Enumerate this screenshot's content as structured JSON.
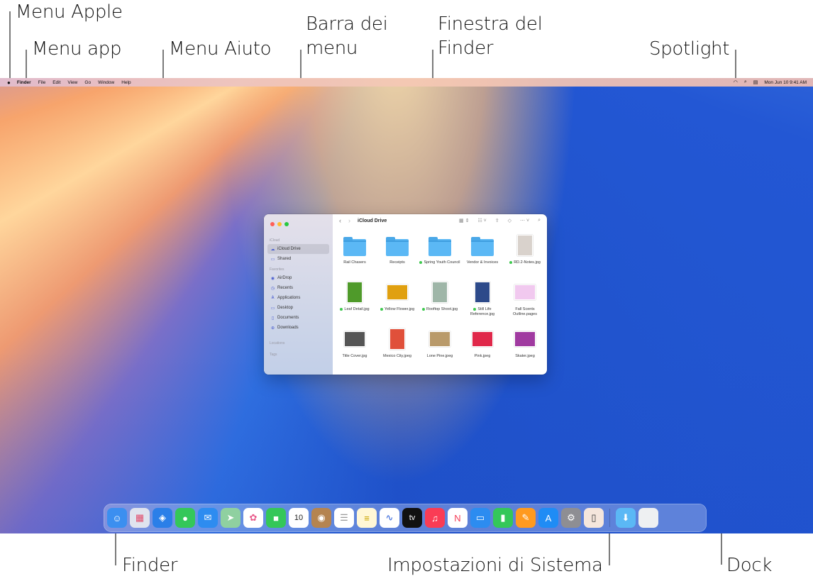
{
  "callouts": {
    "apple_menu": "Menu Apple",
    "app_menu": "Menu app",
    "help_menu": "Menu Aiuto",
    "menu_bar_line1": "Barra dei",
    "menu_bar_line2": "menu",
    "finder_window_line1": "Finestra del",
    "finder_window_line2": "Finder",
    "spotlight": "Spotlight",
    "finder": "Finder",
    "system_settings": "Impostazioni di Sistema",
    "dock": "Dock"
  },
  "menubar": {
    "apple_icon": "apple-icon",
    "items": [
      "Finder",
      "File",
      "Edit",
      "View",
      "Go",
      "Window",
      "Help"
    ],
    "status": {
      "wifi_icon": "wifi-icon",
      "spotlight_icon": "search-icon",
      "control_center_icon": "control-center-icon",
      "datetime": "Mon Jun 10  9:41 AM"
    }
  },
  "finder": {
    "title": "iCloud Drive",
    "sidebar": {
      "sections": [
        {
          "header": "iCloud",
          "items": [
            {
              "label": "iCloud Drive",
              "icon": "cloud-icon",
              "active": true
            },
            {
              "label": "Shared",
              "icon": "shared-folder-icon"
            }
          ]
        },
        {
          "header": "Favorites",
          "items": [
            {
              "label": "AirDrop",
              "icon": "airdrop-icon"
            },
            {
              "label": "Recents",
              "icon": "clock-icon"
            },
            {
              "label": "Applications",
              "icon": "applications-icon"
            },
            {
              "label": "Desktop",
              "icon": "desktop-icon"
            },
            {
              "label": "Documents",
              "icon": "document-icon"
            },
            {
              "label": "Downloads",
              "icon": "download-icon"
            }
          ]
        },
        {
          "header": "Locations",
          "items": []
        },
        {
          "header": "Tags",
          "items": []
        }
      ]
    },
    "toolbar": {
      "back_icon": "chevron-left-icon",
      "forward_icon": "chevron-right-icon",
      "view_icon": "grid-view-icon",
      "group_icon": "group-icon",
      "share_icon": "share-icon",
      "tag_icon": "tag-icon",
      "more_icon": "more-icon",
      "search_icon": "search-icon"
    },
    "files": [
      {
        "name": "Rail Chasers",
        "type": "folder",
        "tag": false
      },
      {
        "name": "Receipts",
        "type": "folder",
        "tag": false
      },
      {
        "name": "Spring Youth Council",
        "type": "folder",
        "tag": true
      },
      {
        "name": "Vendor & Invoices",
        "type": "folder",
        "tag": false
      },
      {
        "name": "RD.2-Notes.jpg",
        "type": "image",
        "tag": true,
        "color": "#d9d2cc"
      },
      {
        "name": "Leaf Detail.jpg",
        "type": "image",
        "tag": true,
        "color": "#4f9a2a"
      },
      {
        "name": "Yellow Flower.jpg",
        "type": "image",
        "tag": true,
        "color": "#e0a010"
      },
      {
        "name": "Rooftop Shoot.jpg",
        "type": "image",
        "tag": true,
        "color": "#9fb6a8"
      },
      {
        "name": "Still Life Reference.jpg",
        "type": "image",
        "tag": true,
        "color": "#2d4a8a"
      },
      {
        "name": "Fall Scents Outline.pages",
        "type": "document",
        "tag": false,
        "color": "#f1c9ef"
      },
      {
        "name": "Title Cover.jpg",
        "type": "image",
        "tag": false,
        "color": "#555555"
      },
      {
        "name": "Mexico City.jpeg",
        "type": "image",
        "tag": false,
        "color": "#e0503a"
      },
      {
        "name": "Lone Pine.jpeg",
        "type": "image",
        "tag": false,
        "color": "#b99a6a"
      },
      {
        "name": "Pink.jpeg",
        "type": "image",
        "tag": false,
        "color": "#e0284a"
      },
      {
        "name": "Skater.jpeg",
        "type": "image",
        "tag": false,
        "color": "#a03aa0"
      }
    ]
  },
  "dock": {
    "apps": [
      {
        "name": "Finder",
        "icon": "finder-icon",
        "glyph": "☺",
        "bg": "#3b8ff0"
      },
      {
        "name": "Launchpad",
        "icon": "launchpad-icon",
        "glyph": "▦",
        "bg": "#dfe3ee",
        "fg": "#e04a6a"
      },
      {
        "name": "Safari",
        "icon": "safari-icon",
        "glyph": "◈",
        "bg": "#2b7fe8"
      },
      {
        "name": "Messages",
        "icon": "messages-icon",
        "glyph": "●",
        "bg": "#34c759"
      },
      {
        "name": "Mail",
        "icon": "mail-icon",
        "glyph": "✉",
        "bg": "#2d8cf0"
      },
      {
        "name": "Maps",
        "icon": "maps-icon",
        "glyph": "➤",
        "bg": "#8fd0a0"
      },
      {
        "name": "Photos",
        "icon": "photos-icon",
        "glyph": "✿",
        "bg": "#ffffff",
        "fg": "#e85a8a"
      },
      {
        "name": "FaceTime",
        "icon": "facetime-icon",
        "glyph": "■",
        "bg": "#34c759"
      },
      {
        "name": "Calendar",
        "icon": "calendar-icon",
        "glyph": "10",
        "bg": "#ffffff",
        "fg": "#222"
      },
      {
        "name": "Contacts",
        "icon": "contacts-icon",
        "glyph": "◉",
        "bg": "#b58450"
      },
      {
        "name": "Reminders",
        "icon": "reminders-icon",
        "glyph": "☰",
        "bg": "#ffffff",
        "fg": "#999"
      },
      {
        "name": "Notes",
        "icon": "notes-icon",
        "glyph": "≡",
        "bg": "#fff7d6",
        "fg": "#c9a400"
      },
      {
        "name": "Freeform",
        "icon": "freeform-icon",
        "glyph": "∿",
        "bg": "#ffffff",
        "fg": "#2b5fd9"
      },
      {
        "name": "Apple TV",
        "icon": "apple-tv-icon",
        "glyph": "tv",
        "bg": "#111111"
      },
      {
        "name": "Music",
        "icon": "music-icon",
        "glyph": "♫",
        "bg": "#fa3c55"
      },
      {
        "name": "News",
        "icon": "news-icon",
        "glyph": "N",
        "bg": "#ffffff",
        "fg": "#f43b55"
      },
      {
        "name": "Keynote",
        "icon": "keynote-icon",
        "glyph": "▭",
        "bg": "#2c8cf0"
      },
      {
        "name": "Numbers",
        "icon": "numbers-icon",
        "glyph": "▮",
        "bg": "#34c759"
      },
      {
        "name": "Pages",
        "icon": "pages-icon",
        "glyph": "✎",
        "bg": "#ff9a1f"
      },
      {
        "name": "App Store",
        "icon": "app-store-icon",
        "glyph": "A",
        "bg": "#1f8cf5"
      },
      {
        "name": "System Settings",
        "icon": "gear-icon",
        "glyph": "⚙",
        "bg": "#8e8e93"
      },
      {
        "name": "iPhone Mirroring",
        "icon": "iphone-mirroring-icon",
        "glyph": "▯",
        "bg": "#f5e6dc",
        "fg": "#333"
      }
    ],
    "stacks": [
      {
        "name": "Downloads",
        "icon": "downloads-folder-icon",
        "glyph": "⬇",
        "bg": "#5bb8f5"
      },
      {
        "name": "Trash",
        "icon": "trash-icon",
        "glyph": "",
        "bg": "#eef0f2"
      }
    ]
  }
}
